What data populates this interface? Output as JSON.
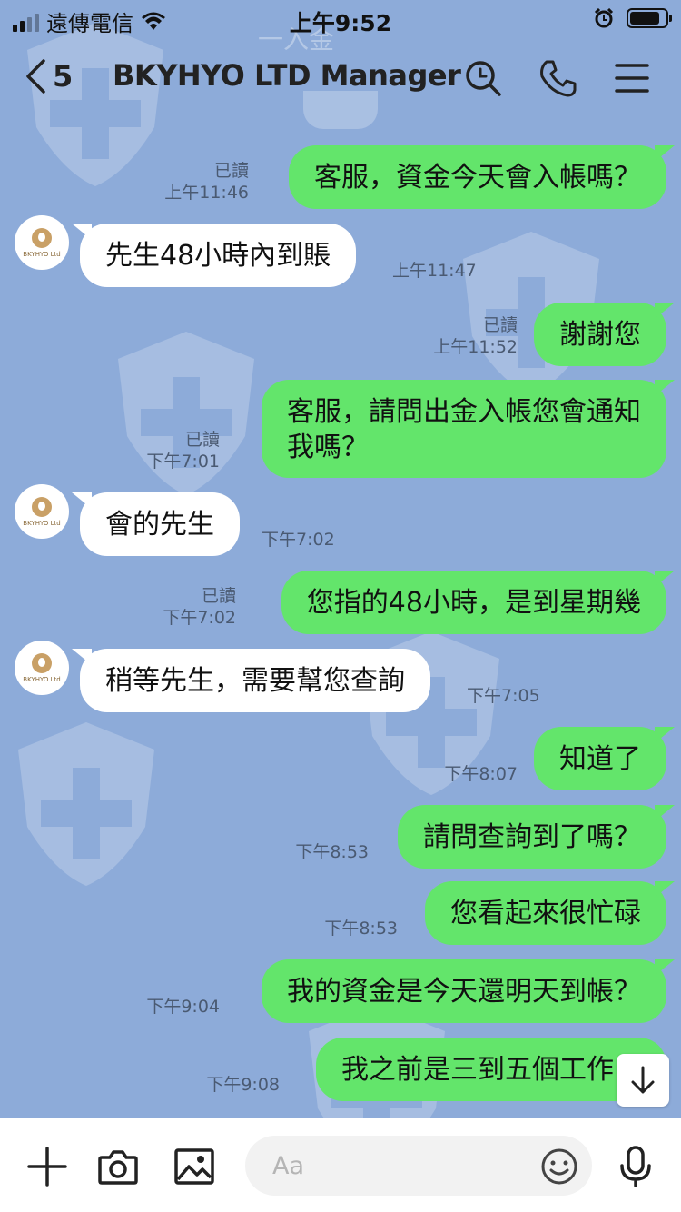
{
  "status_bar": {
    "carrier": "遠傳電信",
    "time": "上午9:52",
    "battery_level": 0.85
  },
  "nav": {
    "back_count": "5",
    "title": "BKYHYO LTD Manager"
  },
  "background_text": "一入金",
  "avatar_brand": "BKYHYO Ltd",
  "messages": [
    {
      "dir": "out",
      "text": "客服，資金今天會入帳嗎？",
      "read": "已讀",
      "time": "上午11:46"
    },
    {
      "dir": "in",
      "text": "先生48小時內到賬",
      "time": "上午11:47"
    },
    {
      "dir": "out",
      "text": "謝謝您",
      "read": "已讀",
      "time": "上午11:52"
    },
    {
      "dir": "out",
      "line1": "客服，請問出金入帳您會通知",
      "line2": "我嗎？",
      "read": "已讀",
      "time": "下午7:01"
    },
    {
      "dir": "in",
      "text": "會的先生",
      "time": "下午7:02"
    },
    {
      "dir": "out",
      "text": "您指的48小時，是到星期幾",
      "read": "已讀",
      "time": "下午7:02"
    },
    {
      "dir": "in",
      "text": "稍等先生，需要幫您查詢",
      "time": "下午7:05"
    },
    {
      "dir": "out",
      "text": "知道了",
      "time": "下午8:07"
    },
    {
      "dir": "out",
      "text": "請問查詢到了嗎？",
      "time": "下午8:53"
    },
    {
      "dir": "out",
      "text": "您看起來很忙碌",
      "time": "下午8:53"
    },
    {
      "dir": "out",
      "text": "我的資金是今天還明天到帳？",
      "time": "下午9:04"
    },
    {
      "dir": "out",
      "text": "我之前是三到五個工作日",
      "time": "下午9:08"
    }
  ],
  "input": {
    "placeholder": "Aa"
  },
  "colors": {
    "background": "#8dabd9",
    "outgoing_bubble": "#63e56b",
    "incoming_bubble": "#ffffff"
  },
  "icons": [
    "back-chevron-icon",
    "search-icon",
    "phone-icon",
    "menu-icon",
    "plus-icon",
    "camera-icon",
    "image-icon",
    "emoji-icon",
    "microphone-icon",
    "arrow-down-icon"
  ]
}
